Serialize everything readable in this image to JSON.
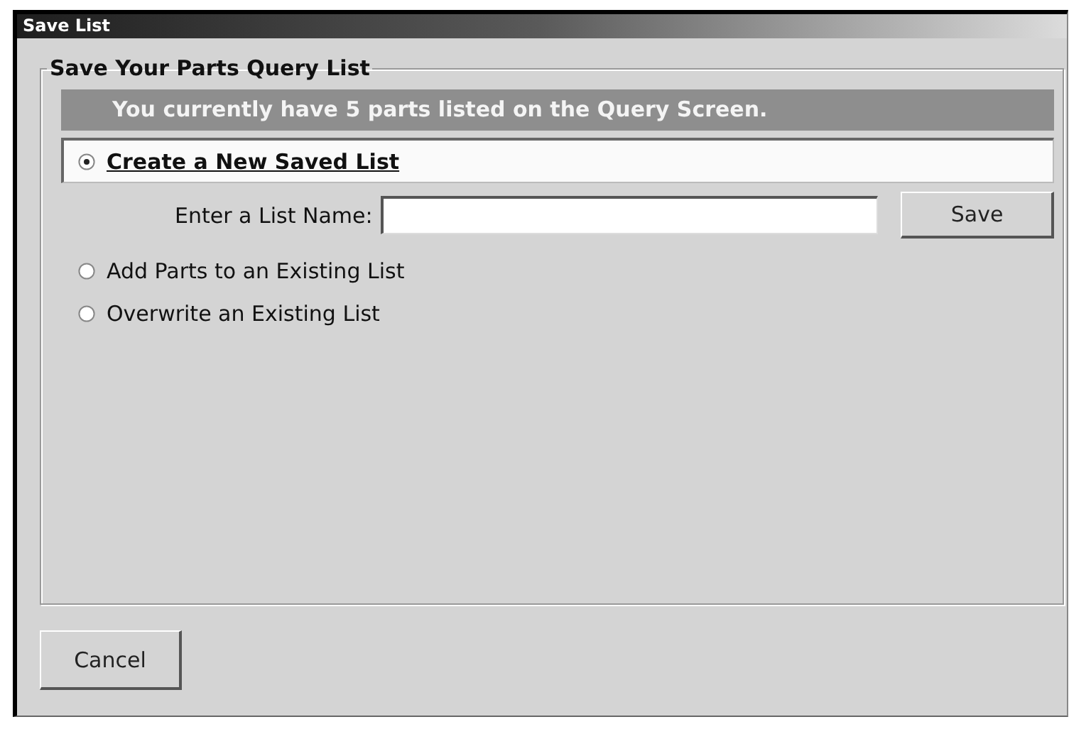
{
  "window": {
    "title": "Save List"
  },
  "group": {
    "legend": "Save Your Parts Query List",
    "banner": "You currently have 5 parts listed on the Query Screen.",
    "options": [
      {
        "label": "Create a New Saved List",
        "selected": true
      },
      {
        "label": "Add Parts to an Existing List",
        "selected": false
      },
      {
        "label": "Overwrite an Existing List",
        "selected": false
      }
    ],
    "name_field": {
      "label": "Enter a List Name:"
    },
    "save_button": "Save"
  },
  "cancel_button": "Cancel"
}
